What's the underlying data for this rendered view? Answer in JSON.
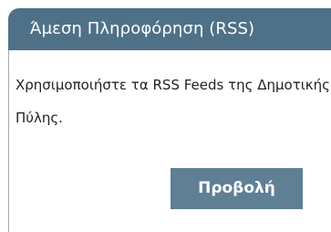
{
  "widget": {
    "title": "Άμεση Πληροφόρηση (RSS)",
    "description": "Χρησιμοποιήστε τα RSS Feeds της Δημοτικής Πύλης.",
    "view_button_label": "Προβολή"
  },
  "colors": {
    "header_bg": "#4f7188",
    "button_bg": "#5f7f94",
    "border": "#a9a9a9"
  }
}
